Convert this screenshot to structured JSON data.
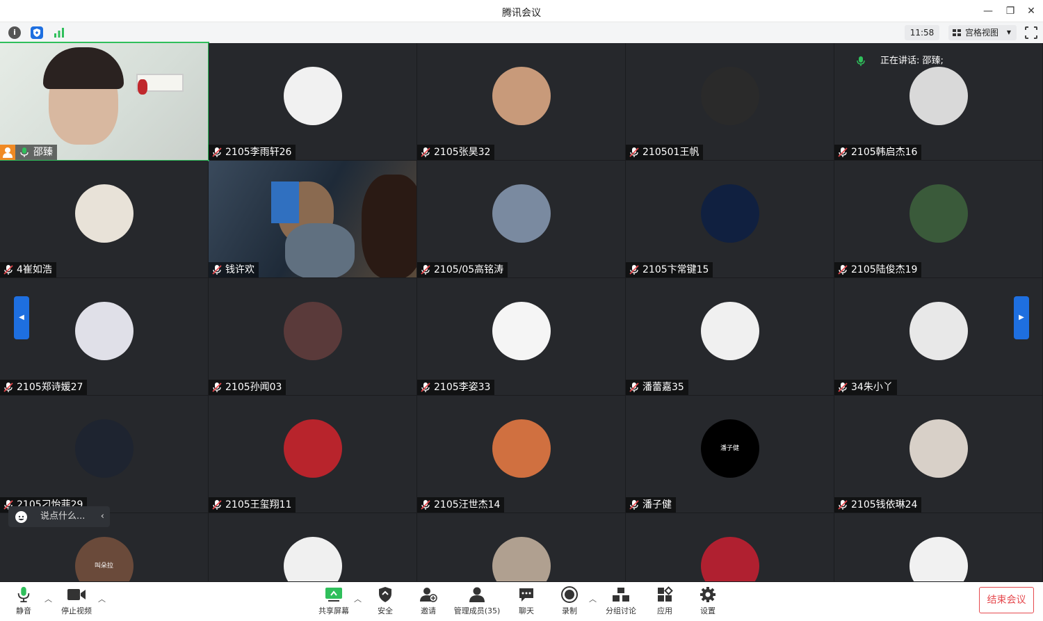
{
  "window": {
    "title": "腾讯会议",
    "minimize_icon": "minimize-icon",
    "restore_icon": "restore-icon",
    "close_icon": "close-icon"
  },
  "toolbar": {
    "info_icon": "info-icon",
    "security_icon": "shield-icon",
    "signal_icon": "signal-bars-icon",
    "time": "11:58",
    "view_label": "宫格视图",
    "fullscreen_icon": "fullscreen-icon"
  },
  "speaking": {
    "label": "正在讲话: 邵臻;"
  },
  "colors": {
    "accent": "#1e6fe0",
    "mic_active": "#2fbf5b",
    "mic_muted": "#e5484d",
    "tile_bg": "#26282c",
    "end_meeting": "#e5484d"
  },
  "participants": [
    {
      "name": "邵臻",
      "host": true,
      "mic": "on",
      "video": true
    },
    {
      "name": "2105李雨轩26",
      "mic": "muted"
    },
    {
      "name": "2105张昊32",
      "mic": "muted"
    },
    {
      "name": "210501王帆",
      "mic": "muted"
    },
    {
      "name": "2105韩启杰16",
      "mic": "muted"
    },
    {
      "name": "4崔如浩",
      "mic": "muted"
    },
    {
      "name": "钱许欢",
      "mic": "muted",
      "video": true
    },
    {
      "name": "2105/05高铭涛",
      "mic": "muted"
    },
    {
      "name": "2105卞常键15",
      "mic": "muted"
    },
    {
      "name": "2105陆俊杰19",
      "mic": "muted"
    },
    {
      "name": "2105郑诗媛27",
      "mic": "muted"
    },
    {
      "name": "2105孙闻03",
      "mic": "muted"
    },
    {
      "name": "2105李姿33",
      "mic": "muted"
    },
    {
      "name": "潘蕾嘉35",
      "mic": "muted"
    },
    {
      "name": "34朱小丫",
      "mic": "muted"
    },
    {
      "name": "2105刁怡菲29",
      "mic": "muted"
    },
    {
      "name": "2105王玺翔11",
      "mic": "muted"
    },
    {
      "name": "2105汪世杰14",
      "mic": "muted"
    },
    {
      "name": "潘子健",
      "mic": "muted",
      "avatar_text": "潘子健"
    },
    {
      "name": "2105钱依琳24",
      "mic": "muted"
    },
    {
      "name": "",
      "mic": "muted",
      "avatar_text": "叫朵拉"
    },
    {
      "name": "",
      "mic": "muted"
    },
    {
      "name": "",
      "mic": "muted"
    },
    {
      "name": "",
      "mic": "muted"
    },
    {
      "name": "",
      "mic": "muted"
    }
  ],
  "chat": {
    "placeholder": "说点什么..."
  },
  "bottombar": {
    "mute": "静音",
    "stop_video": "停止视频",
    "share_screen": "共享屏幕",
    "security": "安全",
    "invite": "邀请",
    "manage_members": "管理成员(35)",
    "chat": "聊天",
    "record": "录制",
    "breakout": "分组讨论",
    "apps": "应用",
    "settings": "设置",
    "end_meeting": "结束会议"
  }
}
